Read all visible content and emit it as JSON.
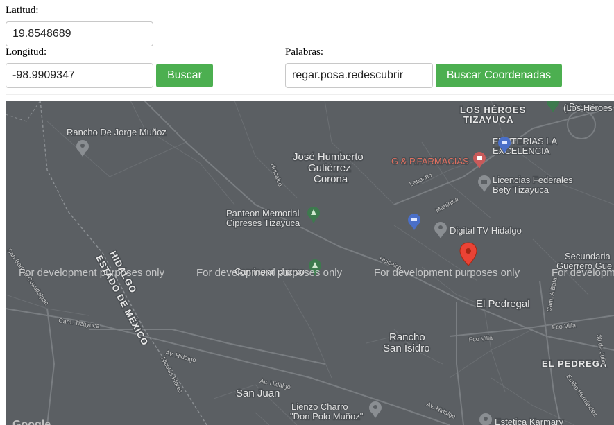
{
  "form": {
    "lat_label": "Latitud:",
    "lat_value": "19.8548689",
    "lng_label": "Longitud:",
    "lng_value": "-98.9909347",
    "search_label": "Buscar",
    "words_label": "Palabras:",
    "words_value": "regar.posa.redescubrir",
    "coords_button_label": "Buscar Coordenadas"
  },
  "map": {
    "watermark": "For development purposes only",
    "google_logo": "Google",
    "places": {
      "rancho_jorge": "Rancho De Jorge Muñoz",
      "jose_humberto_1": "José Humberto",
      "jose_humberto_2": "Gutiérrez",
      "jose_humberto_3": "Corona",
      "panteon_1": "Panteon Memorial",
      "panteon_2": "Cipreses Tizayuca",
      "heroes_1": "LOS HÉROES",
      "heroes_2": "TIZAYUCA",
      "heroes_right_1": "Bosque",
      "heroes_right_2": "(Los Héroes",
      "fruterias_1": "FRUTERIAS LA",
      "fruterias_2": "EXCELENCIA",
      "farmacias": "G & P.FARMACIAS",
      "licencias_1": "Licencias Federales",
      "licencias_2": "Bety Tizayuca",
      "digital_tv": "Digital TV Hidalgo",
      "secundaria_1": "Secundaria",
      "secundaria_2": "Guerrero Gue",
      "el_pedregal": "El Pedregal",
      "el_pedregal_caps": "EL PEDREGA",
      "rancho_isidro_1": "Rancho",
      "rancho_isidro_2": "San Isidro",
      "san_juan": "San Juan",
      "lienzo_1": "Lienzo Charro",
      "lienzo_2": "\"Don Polo Muñoz\"",
      "estetica": "Estetica Karmary",
      "camino": "Camino al charco",
      "estado_1": "ESTADO DE MÉXICO",
      "estado_2": "HIDALGO"
    },
    "roads": {
      "huicalco_1": "Huicalco",
      "huicalco_2": "Huicalco",
      "lapacho": "Lapacho",
      "martinica": "Martinica",
      "cam_tizayuca": "Cam. Tizayuca",
      "av_hidalgo_1": "Av. Hidalgo",
      "av_hidalgo_2": "Av. Hidalgo",
      "av_hidalgo_3": "Av. Hidalgo",
      "nicolas_flores": "Nicolás Flores",
      "fco_villa_1": "Fco Villa",
      "fco_villa_2": "Fco Villa",
      "cam_a_bata": "Cam. A Bata",
      "av_30_julio": "30 de Julio",
      "emilio": "Emilio Hernández",
      "san_bartolo": "San Bartolo Cuautlalpan"
    }
  }
}
